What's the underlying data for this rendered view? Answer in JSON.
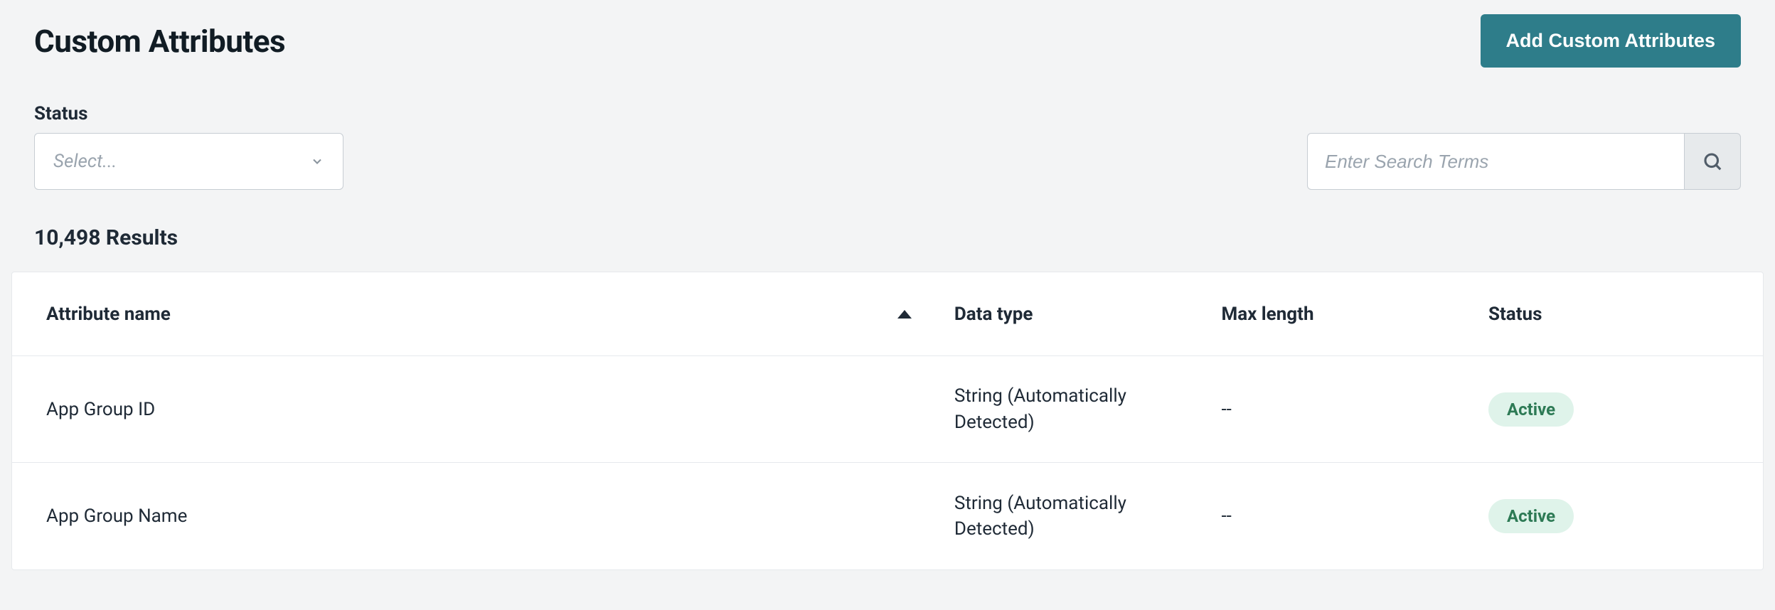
{
  "header": {
    "title": "Custom Attributes",
    "add_button": "Add Custom Attributes"
  },
  "filters": {
    "status_label": "Status",
    "status_placeholder": "Select...",
    "search_placeholder": "Enter Search Terms"
  },
  "results": {
    "count_text": "10,498 Results"
  },
  "table": {
    "columns": {
      "name": "Attribute name",
      "datatype": "Data type",
      "maxlen": "Max length",
      "status": "Status"
    },
    "rows": [
      {
        "name": "App Group ID",
        "datatype": "String (Automatically Detected)",
        "maxlen": "--",
        "status": "Active"
      },
      {
        "name": "App Group Name",
        "datatype": "String (Automatically Detected)",
        "maxlen": "--",
        "status": "Active"
      }
    ]
  }
}
